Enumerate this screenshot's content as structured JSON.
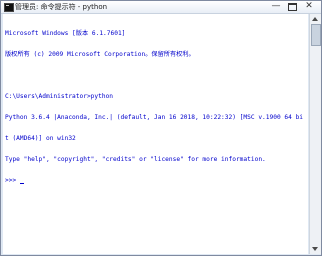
{
  "window": {
    "title": "管理员: 命令提示符 - python",
    "controls": {
      "minimize": "—",
      "close": "✕"
    }
  },
  "console": {
    "lines": [
      "Microsoft Windows [版本 6.1.7601]",
      "版权所有 (c) 2009 Microsoft Corporation。保留所有权利。",
      "",
      "C:\\Users\\Administrator>python",
      "Python 3.6.4 |Anaconda, Inc.| (default, Jan 16 2018, 10:22:32) [MSC v.1900 64 bi",
      "t (AMD64)] on win32",
      "Type \"help\", \"copyright\", \"credits\" or \"license\" for more information."
    ],
    "prompt": ">>> "
  },
  "colors": {
    "text": "#0000cc",
    "background": "#ffffff"
  }
}
